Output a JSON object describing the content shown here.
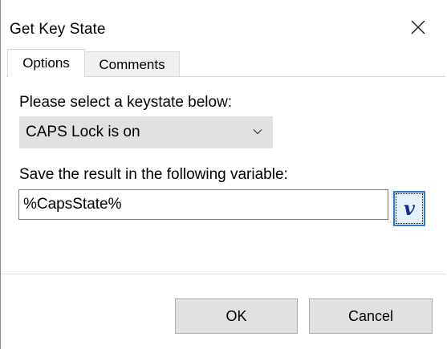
{
  "window": {
    "title": "Get Key State",
    "close_icon": "close-icon"
  },
  "tabs": [
    {
      "label": "Options",
      "active": true
    },
    {
      "label": "Comments",
      "active": false
    }
  ],
  "options": {
    "keystate_label": "Please select a keystate below:",
    "keystate_value": "CAPS Lock is on",
    "variable_label": "Save the result in the following variable:",
    "variable_value": "%CapsState%",
    "variable_button_label": "v"
  },
  "footer": {
    "ok_label": "OK",
    "cancel_label": "Cancel"
  },
  "colors": {
    "focus_border": "#2a7ad3",
    "button_face": "#e1e1e1",
    "variable_button_face": "#e5f1fb"
  }
}
